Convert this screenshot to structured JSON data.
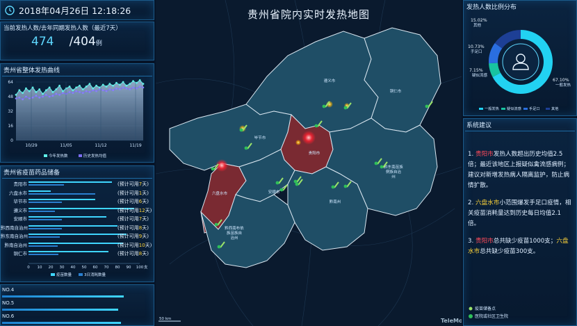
{
  "clock": {
    "datetime": "2018年04月26日 12:18:26"
  },
  "fever_count": {
    "title": "当前发热人数/去年同期发热人数（最近7天）",
    "current": "474",
    "sep_last": "/404",
    "unit": "例"
  },
  "curve": {
    "title": "贵州省整体发热曲线",
    "legend_this": "今年发热数",
    "legend_hist": "历史发热均值",
    "chart_data": {
      "type": "area",
      "x_ticks": [
        "10/29",
        "11/05",
        "11/12",
        "11/19"
      ],
      "y_ticks": [
        "0",
        "16",
        "32",
        "48",
        "64"
      ],
      "ylim": [
        0,
        64
      ],
      "series": [
        {
          "name": "今年发热数",
          "values": [
            50,
            55,
            52,
            57,
            54,
            58,
            53,
            56,
            51,
            55,
            58,
            53,
            56,
            60,
            54,
            57,
            59,
            55,
            58,
            60,
            56,
            59,
            62,
            57,
            60,
            58,
            61,
            59,
            62,
            60,
            63,
            61,
            64,
            60,
            62,
            65,
            63,
            66,
            62
          ]
        },
        {
          "name": "历史发热均值",
          "values": [
            46,
            47,
            45,
            48,
            46,
            47,
            49,
            47,
            48,
            50,
            48,
            49,
            51,
            50,
            52,
            51,
            53,
            52,
            54,
            53,
            52,
            54,
            53,
            55,
            54,
            56,
            55,
            54,
            56,
            55,
            57,
            56,
            58,
            57,
            56,
            58,
            57,
            59,
            58
          ]
        }
      ]
    }
  },
  "vaccine": {
    "title": "贵州省疫苗药品储备",
    "rows": [
      {
        "name": "贵阳市",
        "pre": "(预计可用",
        "days": "7",
        "post": "天)"
      },
      {
        "name": "六盘水市",
        "pre": "(预计可用",
        "days": "1",
        "post": "天)"
      },
      {
        "name": "毕节市",
        "pre": "(预计可用",
        "days": "6",
        "post": "天)"
      },
      {
        "name": "遵义市",
        "pre": "(预计可用",
        "days": "12",
        "post": "天)"
      },
      {
        "name": "安顺市",
        "pre": "(预计可用",
        "days": "7",
        "post": "天)"
      },
      {
        "name": "黔西南自治州",
        "pre": "(预计可用",
        "days": "8",
        "post": "天)"
      },
      {
        "name": "黔东南自治州",
        "pre": "(预计可用",
        "days": "9",
        "post": "天)"
      },
      {
        "name": "黔南自治州",
        "pre": "(预计可用",
        "days": "10",
        "post": "天)"
      },
      {
        "name": "铜仁市",
        "pre": "(预计可用",
        "days": "8",
        "post": "天)"
      }
    ],
    "x_ticks": [
      "0",
      "10",
      "20",
      "30",
      "40",
      "50",
      "60",
      "70",
      "80",
      "90",
      "100"
    ],
    "x_unit": "支",
    "legend_stock": "疫苗数量",
    "legend_use": "3日消耗数量",
    "chart_data": {
      "type": "bar",
      "categories": [
        "贵阳市",
        "六盘水市",
        "毕节市",
        "遵义市",
        "安顺市",
        "黔西南自治州",
        "黔东南自治州",
        "黔南自治州",
        "铜仁市"
      ],
      "series": [
        {
          "name": "疫苗数量",
          "values": [
            75,
            20,
            60,
            95,
            70,
            80,
            88,
            85,
            72
          ]
        },
        {
          "name": "3日消耗数量",
          "values": [
            32,
            60,
            30,
            24,
            30,
            30,
            28,
            26,
            27
          ]
        }
      ],
      "xlim": [
        0,
        100
      ]
    }
  },
  "no_list": [
    {
      "label": "NO.4",
      "value": 82
    },
    {
      "label": "NO.5",
      "value": 78
    },
    {
      "label": "NO.6",
      "value": 80
    }
  ],
  "map": {
    "title": "贵州省院内实时发热地图",
    "cities": [
      "遵义市",
      "铜仁市",
      "毕节市",
      "贵阳市",
      "六盘水市",
      "安顺市",
      "黔南州",
      "黔西南布依族苗族自治州",
      "黔东南苗族侗族自治州"
    ],
    "scale": "50 km",
    "watermark": "TeleMod",
    "legend_hospital": "疫苗储备点",
    "legend_clinic": "医院或社区卫生院",
    "colors": {
      "normal": "#1f4e66",
      "hot": "#7a2a32",
      "border": "#d9e6f0"
    }
  },
  "pie": {
    "title": "发热人数比例分布",
    "chart_data": {
      "type": "pie",
      "slices": [
        {
          "name": "一般发热",
          "value": 67.1,
          "label": "67.10%",
          "sub": "一般发热",
          "color": "#22d2f2"
        },
        {
          "name": "疑似流感",
          "value": 7.15,
          "label": "7.15%",
          "sub": "疑似流感",
          "color": "#18c3a0"
        },
        {
          "name": "手足口",
          "value": 10.73,
          "label": "10.73%",
          "sub": "手足口",
          "color": "#2a6ee0"
        },
        {
          "name": "其他",
          "value": 15.02,
          "label": "15.02%",
          "sub": "其他",
          "color": "#1d3f95"
        }
      ]
    },
    "legend": [
      "一般发热",
      "疑似流感",
      "手足口",
      "其他"
    ]
  },
  "advice": {
    "title": "系统建议",
    "p1_a": "1. ",
    "p1_city": "贵阳市",
    "p1_b": "发热人数超出历史均值2.5倍；最近该地区上报疑似禽流感病例；建议对新增发热病人隔离监护，防止病情扩散。",
    "p2_a": "2. ",
    "p2_city": "六盘水市",
    "p2_b": "小范围爆发手足口疫情，相关疫苗消耗量达到历史每日均值2.1倍。",
    "p3_a": "3. ",
    "p3_city": "贵阳市",
    "p3_b": "总共缺少疫苗1000支；",
    "p3_city2": "六盘水市",
    "p3_c": "总共缺少疫苗300支。"
  }
}
